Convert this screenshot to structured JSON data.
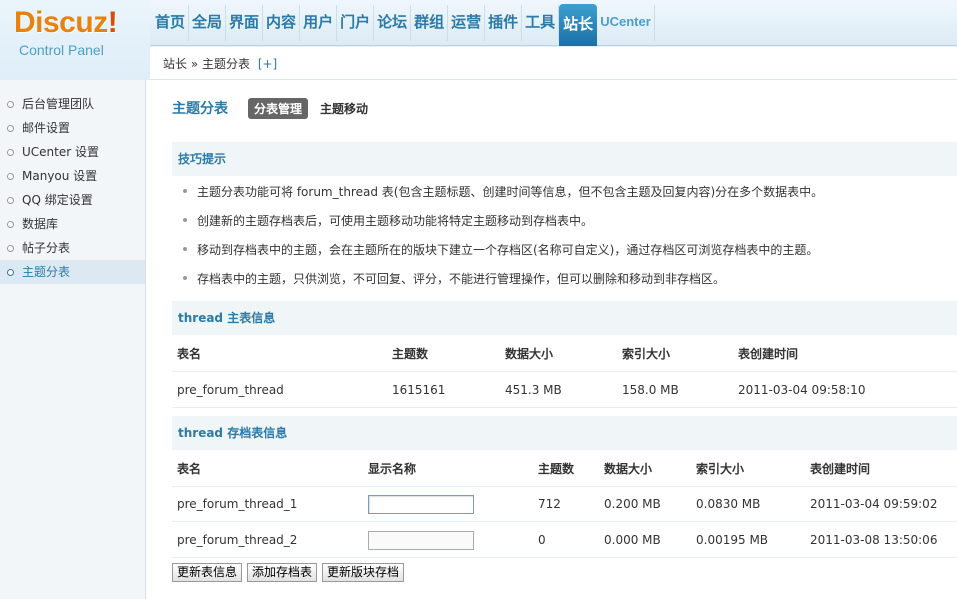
{
  "logo": {
    "title": "Discuz",
    "bang": "!",
    "subtitle": "Control Panel"
  },
  "topnav": {
    "items": [
      "首页",
      "全局",
      "界面",
      "内容",
      "用户",
      "门户",
      "论坛",
      "群组",
      "运营",
      "插件",
      "工具",
      "站长",
      "UCenter"
    ],
    "active": "站长"
  },
  "breadcrumb": {
    "path": "站长 » 主题分表",
    "add": "[+]"
  },
  "sidebar": {
    "items": [
      "后台管理团队",
      "邮件设置",
      "UCenter 设置",
      "Manyou 设置",
      "QQ 绑定设置",
      "数据库",
      "帖子分表",
      "主题分表"
    ],
    "active": "主题分表"
  },
  "main": {
    "title": "主题分表",
    "tabs": [
      "分表管理",
      "主题移动"
    ],
    "tips_title": "技巧提示",
    "tips": [
      "主题分表功能可将 forum_thread 表(包含主题标题、创建时间等信息，但不包含主题及回复内容)分在多个数据表中。",
      "创建新的主题存档表后，可使用主题移动功能将特定主题移动到存档表中。",
      "移动到存档表中的主题，会在主题所在的版块下建立一个存档区(名称可自定义)，通过存档区可浏览存档表中的主题。",
      "存档表中的主题，只供浏览，不可回复、评分，不能进行管理操作，但可以删除和移动到非存档区。"
    ],
    "main_table": {
      "title": "thread 主表信息",
      "headers": [
        "表名",
        "主题数",
        "数据大小",
        "索引大小",
        "表创建时间"
      ],
      "row": [
        "pre_forum_thread",
        "1615161",
        "451.3 MB",
        "158.0 MB",
        "2011-03-04 09:58:10"
      ]
    },
    "archive_table": {
      "title": "thread 存档表信息",
      "headers": [
        "表名",
        "显示名称",
        "主题数",
        "数据大小",
        "索引大小",
        "表创建时间"
      ],
      "rows": [
        [
          "pre_forum_thread_1",
          "",
          "712",
          "0.200 MB",
          "0.0830 MB",
          "2011-03-04 09:59:02"
        ],
        [
          "pre_forum_thread_2",
          "",
          "0",
          "0.000 MB",
          "0.00195 MB",
          "2011-03-08 13:50:06"
        ]
      ]
    },
    "buttons": [
      "更新表信息",
      "添加存档表",
      "更新版块存档"
    ]
  }
}
